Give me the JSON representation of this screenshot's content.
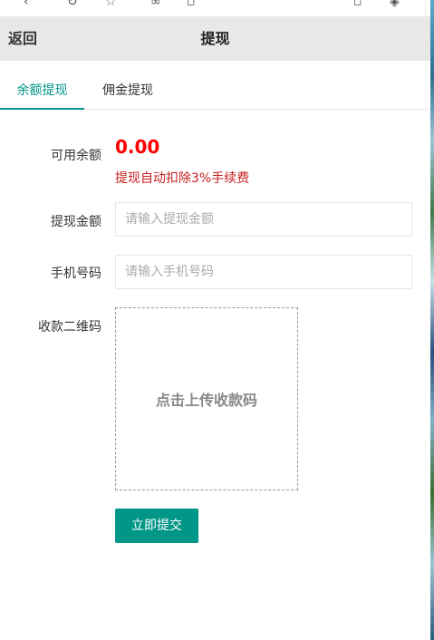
{
  "header": {
    "back_label": "返回",
    "title": "提现"
  },
  "tabs": [
    {
      "label": "余额提现",
      "active": true
    },
    {
      "label": "佣金提现",
      "active": false
    }
  ],
  "form": {
    "balance_label": "可用余额",
    "balance_value": "0.00",
    "fee_note": "提现自动扣除3%手续费",
    "amount_label": "提现金额",
    "amount_placeholder": "请输入提现金额",
    "phone_label": "手机号码",
    "phone_placeholder": "请输入手机号码",
    "qrcode_label": "收款二维码",
    "upload_text": "点击上传收款码",
    "submit_label": "立即提交"
  },
  "colors": {
    "accent": "#009688",
    "balance": "#ff0000",
    "fee_note": "#c81e1e",
    "header_bg": "#e8e8e8"
  }
}
